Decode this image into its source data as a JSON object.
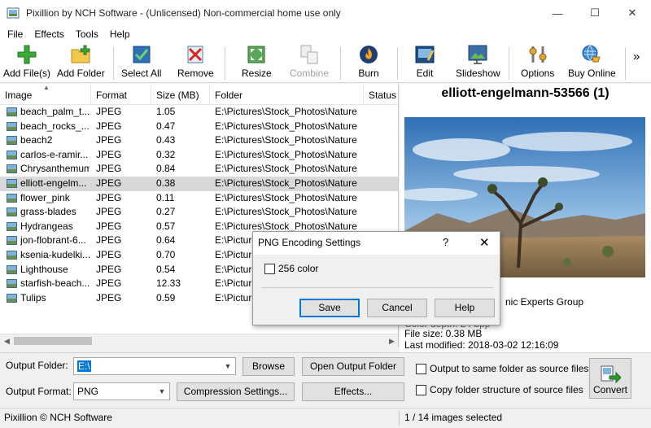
{
  "window": {
    "title": "Pixillion by NCH Software - (Unlicensed) Non-commercial home use only",
    "minimize_glyph": "—",
    "maximize_glyph": "☐",
    "close_glyph": "✕"
  },
  "menu": [
    "File",
    "Effects",
    "Tools",
    "Help"
  ],
  "toolbar": {
    "add_files": "Add File(s)",
    "add_folder": "Add Folder",
    "select_all": "Select All",
    "remove": "Remove",
    "resize": "Resize",
    "combine": "Combine",
    "burn": "Burn",
    "edit": "Edit",
    "slideshow": "Slideshow",
    "options": "Options",
    "buy_online": "Buy Online",
    "more": "»"
  },
  "filelist": {
    "columns": [
      "Image",
      "Format",
      "Size (MB)",
      "Folder",
      "Status"
    ],
    "rows": [
      {
        "image": "beach_palm_t...",
        "format": "JPEG",
        "size": "1.05",
        "folder": "E:\\Pictures\\Stock_Photos\\Nature"
      },
      {
        "image": "beach_rocks_...",
        "format": "JPEG",
        "size": "0.47",
        "folder": "E:\\Pictures\\Stock_Photos\\Nature"
      },
      {
        "image": "beach2",
        "format": "JPEG",
        "size": "0.43",
        "folder": "E:\\Pictures\\Stock_Photos\\Nature"
      },
      {
        "image": "carlos-e-ramir...",
        "format": "JPEG",
        "size": "0.32",
        "folder": "E:\\Pictures\\Stock_Photos\\Nature"
      },
      {
        "image": "Chrysanthemum",
        "format": "JPEG",
        "size": "0.84",
        "folder": "E:\\Pictures\\Stock_Photos\\Nature"
      },
      {
        "image": "elliott-engelm...",
        "format": "JPEG",
        "size": "0.38",
        "folder": "E:\\Pictures\\Stock_Photos\\Nature"
      },
      {
        "image": "flower_pink",
        "format": "JPEG",
        "size": "0.11",
        "folder": "E:\\Pictures\\Stock_Photos\\Nature"
      },
      {
        "image": "grass-blades",
        "format": "JPEG",
        "size": "0.27",
        "folder": "E:\\Pictures\\Stock_Photos\\Nature"
      },
      {
        "image": "Hydrangeas",
        "format": "JPEG",
        "size": "0.57",
        "folder": "E:\\Pictures\\Stock_Photos\\Nature"
      },
      {
        "image": "jon-flobrant-6...",
        "format": "JPEG",
        "size": "0.64",
        "folder": "E:\\Picture"
      },
      {
        "image": "ksenia-kudelki...",
        "format": "JPEG",
        "size": "0.70",
        "folder": "E:\\Picture"
      },
      {
        "image": "Lighthouse",
        "format": "JPEG",
        "size": "0.54",
        "folder": "E:\\Picture"
      },
      {
        "image": "starfish-beach...",
        "format": "JPEG",
        "size": "12.33",
        "folder": "E:\\Picture"
      },
      {
        "image": "Tulips",
        "format": "JPEG",
        "size": "0.59",
        "folder": "E:\\Picture"
      }
    ]
  },
  "preview": {
    "title": "elliott-engelmann-53566 (1)",
    "info_partial": "nic Experts Group",
    "info_partial2": "Color depth: 24 bpp",
    "file_size": "File size: 0.38 MB",
    "last_modified": "Last modified: 2018-03-02 12:16:09"
  },
  "output": {
    "folder_label": "Output Folder:",
    "folder_value": "E:\\",
    "browse": "Browse",
    "open_folder": "Open Output Folder",
    "same_folder": "Output to same folder as source files",
    "format_label": "Output Format:",
    "format_value": "PNG",
    "compression": "Compression Settings...",
    "effects": "Effects...",
    "copy_structure": "Copy folder structure of source files",
    "convert": "Convert"
  },
  "status": {
    "left": "Pixillion © NCH Software",
    "right": "1 / 14 images selected"
  },
  "dialog": {
    "title": "PNG Encoding Settings",
    "help_glyph": "?",
    "close_glyph": "✕",
    "checkbox_256": "256 color",
    "save": "Save",
    "cancel": "Cancel",
    "help": "Help"
  }
}
